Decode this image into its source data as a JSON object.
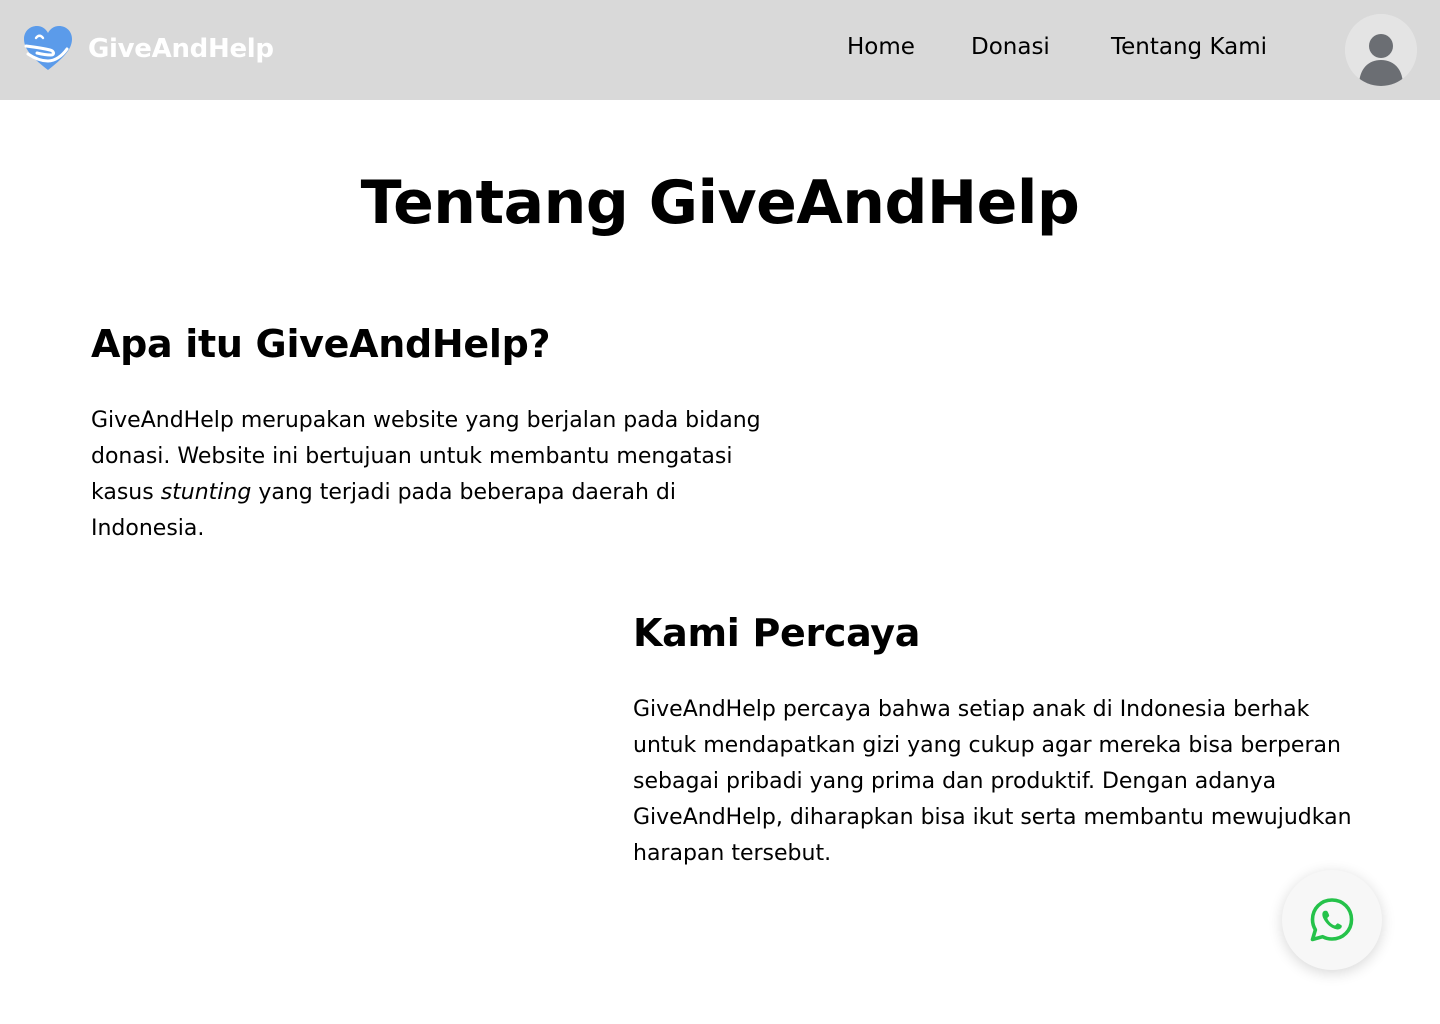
{
  "brand": {
    "name": "GiveAndHelp",
    "logo_icon": "heart-hand-icon",
    "logo_color": "#5b9bea"
  },
  "nav": {
    "items": [
      {
        "label": "Home"
      },
      {
        "label": "Donasi"
      },
      {
        "label": "Tentang Kami"
      }
    ],
    "avatar_icon": "user-avatar-icon",
    "background": "#d9d9d9"
  },
  "page": {
    "title": "Tentang GiveAndHelp"
  },
  "sections": [
    {
      "heading": "Apa itu GiveAndHelp?",
      "body_before": "GiveAndHelp merupakan website yang berjalan pada bidang donasi. Website ini bertujuan untuk membantu mengatasi kasus ",
      "body_emphasis": "stunting",
      "body_after": " yang terjadi pada beberapa daerah di Indonesia."
    },
    {
      "heading": "Kami Percaya",
      "body": "GiveAndHelp percaya bahwa setiap anak di Indonesia berhak untuk mendapatkan gizi yang cukup agar mereka bisa berperan sebagai pribadi yang prima dan produktif. Dengan adanya GiveAndHelp, diharapkan bisa ikut serta membantu mewujudkan harapan tersebut."
    }
  ],
  "whatsapp_button": {
    "icon": "whatsapp-icon",
    "color": "#25c24a"
  }
}
